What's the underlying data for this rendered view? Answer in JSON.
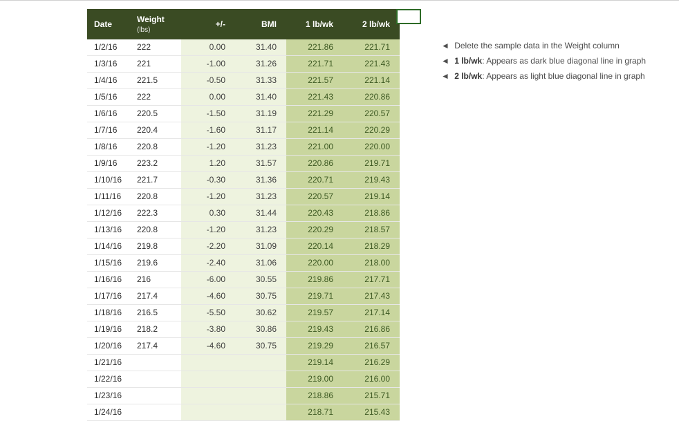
{
  "headers": {
    "date": "Date",
    "weight": "Weight",
    "weight_unit": "(lbs)",
    "pm": "+/-",
    "bmi": "BMI",
    "lb1": "1 lb/wk",
    "lb2": "2 lb/wk"
  },
  "rows": [
    {
      "date": "1/2/16",
      "weight": "222",
      "pm": "0.00",
      "bmi": "31.40",
      "lb1": "221.86",
      "lb2": "221.71"
    },
    {
      "date": "1/3/16",
      "weight": "221",
      "pm": "-1.00",
      "bmi": "31.26",
      "lb1": "221.71",
      "lb2": "221.43"
    },
    {
      "date": "1/4/16",
      "weight": "221.5",
      "pm": "-0.50",
      "bmi": "31.33",
      "lb1": "221.57",
      "lb2": "221.14"
    },
    {
      "date": "1/5/16",
      "weight": "222",
      "pm": "0.00",
      "bmi": "31.40",
      "lb1": "221.43",
      "lb2": "220.86"
    },
    {
      "date": "1/6/16",
      "weight": "220.5",
      "pm": "-1.50",
      "bmi": "31.19",
      "lb1": "221.29",
      "lb2": "220.57"
    },
    {
      "date": "1/7/16",
      "weight": "220.4",
      "pm": "-1.60",
      "bmi": "31.17",
      "lb1": "221.14",
      "lb2": "220.29"
    },
    {
      "date": "1/8/16",
      "weight": "220.8",
      "pm": "-1.20",
      "bmi": "31.23",
      "lb1": "221.00",
      "lb2": "220.00"
    },
    {
      "date": "1/9/16",
      "weight": "223.2",
      "pm": "1.20",
      "bmi": "31.57",
      "lb1": "220.86",
      "lb2": "219.71"
    },
    {
      "date": "1/10/16",
      "weight": "221.7",
      "pm": "-0.30",
      "bmi": "31.36",
      "lb1": "220.71",
      "lb2": "219.43"
    },
    {
      "date": "1/11/16",
      "weight": "220.8",
      "pm": "-1.20",
      "bmi": "31.23",
      "lb1": "220.57",
      "lb2": "219.14"
    },
    {
      "date": "1/12/16",
      "weight": "222.3",
      "pm": "0.30",
      "bmi": "31.44",
      "lb1": "220.43",
      "lb2": "218.86"
    },
    {
      "date": "1/13/16",
      "weight": "220.8",
      "pm": "-1.20",
      "bmi": "31.23",
      "lb1": "220.29",
      "lb2": "218.57"
    },
    {
      "date": "1/14/16",
      "weight": "219.8",
      "pm": "-2.20",
      "bmi": "31.09",
      "lb1": "220.14",
      "lb2": "218.29"
    },
    {
      "date": "1/15/16",
      "weight": "219.6",
      "pm": "-2.40",
      "bmi": "31.06",
      "lb1": "220.00",
      "lb2": "218.00"
    },
    {
      "date": "1/16/16",
      "weight": "216",
      "pm": "-6.00",
      "bmi": "30.55",
      "lb1": "219.86",
      "lb2": "217.71"
    },
    {
      "date": "1/17/16",
      "weight": "217.4",
      "pm": "-4.60",
      "bmi": "30.75",
      "lb1": "219.71",
      "lb2": "217.43"
    },
    {
      "date": "1/18/16",
      "weight": "216.5",
      "pm": "-5.50",
      "bmi": "30.62",
      "lb1": "219.57",
      "lb2": "217.14"
    },
    {
      "date": "1/19/16",
      "weight": "218.2",
      "pm": "-3.80",
      "bmi": "30.86",
      "lb1": "219.43",
      "lb2": "216.86"
    },
    {
      "date": "1/20/16",
      "weight": "217.4",
      "pm": "-4.60",
      "bmi": "30.75",
      "lb1": "219.29",
      "lb2": "216.57"
    },
    {
      "date": "1/21/16",
      "weight": "",
      "pm": "",
      "bmi": "",
      "lb1": "219.14",
      "lb2": "216.29"
    },
    {
      "date": "1/22/16",
      "weight": "",
      "pm": "",
      "bmi": "",
      "lb1": "219.00",
      "lb2": "216.00"
    },
    {
      "date": "1/23/16",
      "weight": "",
      "pm": "",
      "bmi": "",
      "lb1": "218.86",
      "lb2": "215.71"
    },
    {
      "date": "1/24/16",
      "weight": "",
      "pm": "",
      "bmi": "",
      "lb1": "218.71",
      "lb2": "215.43"
    }
  ],
  "notes": {
    "n1_pre": "◄ ",
    "n1": "Delete the sample data in the Weight column",
    "n2_pre": "◄ ",
    "n2_b": "1 lb/wk",
    "n2": ": Appears as dark blue diagonal line in graph",
    "n3_pre": "◄ ",
    "n3_b": "2 lb/wk",
    "n3": ": Appears as light blue diagonal line in graph"
  }
}
